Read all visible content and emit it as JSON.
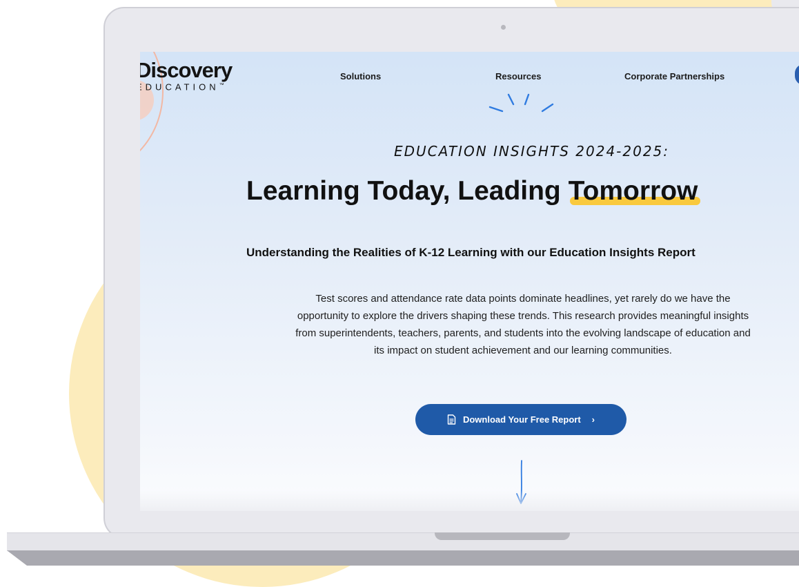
{
  "nav": {
    "logo_main": "Discovery",
    "logo_sub": "EDUCATION",
    "logo_tm": "™",
    "links": [
      "Solutions",
      "Resources",
      "Corporate Partnerships"
    ]
  },
  "hero": {
    "eyebrow": "EDUCATION INSIGHTS 2024-2025:",
    "headline_prefix": "Learning Today, Leading ",
    "headline_highlight": "Tomorrow",
    "subhead": "Understanding the Realities of K-12 Learning with our Education Insights Report",
    "body_lines": [
      "Test scores and attendance rate data points dominate headlines, yet rarely do we have the",
      "opportunity to explore the drivers shaping these trends. This research provides meaningful insights",
      "from superintendents, teachers, parents, and students into the evolving landscape of education and",
      "its impact on student achievement and our learning communities."
    ],
    "cta_label": "Download Your Free Report",
    "cta_chevron": "›"
  },
  "icons": {
    "cta_icon": "document-icon",
    "cta_chevron_icon": "chevron-right-icon",
    "scroll_icon": "arrow-down-icon",
    "sparkle_icon": "sparkle-icon"
  },
  "colors": {
    "primary": "#1f5aa8",
    "highlight": "#f9c93e",
    "accent_yellow": "#fbe6a6",
    "accent_peach": "#f2b8a4"
  }
}
